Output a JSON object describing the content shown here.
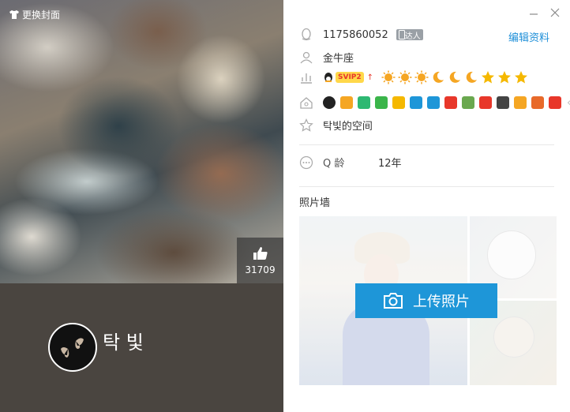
{
  "cover": {
    "change_label": "更换封面",
    "likes": "31709"
  },
  "profile": {
    "nickname": "탁 빛"
  },
  "info": {
    "qq_number": "1175860052",
    "daren_badge": "达人",
    "edit_label": "编辑资料",
    "zodiac": "金牛座",
    "vip_label": "SVIP2",
    "space_name": "탁빛的空间",
    "age_label": "Q 龄",
    "age_value": "12年",
    "photo_wall_title": "照片墙",
    "upload_label": "上传照片"
  },
  "level_icons": [
    "sun-icon",
    "sun-icon",
    "sun-icon",
    "moon-icon",
    "moon-icon",
    "moon-icon",
    "star-icon",
    "star-icon",
    "star-icon"
  ],
  "service_badges": [
    "qq-penguin-icon",
    "badge-1",
    "badge-2",
    "badge-3",
    "badge-4",
    "badge-5",
    "badge-6",
    "badge-7",
    "badge-8",
    "badge-9",
    "badge-10",
    "badge-11",
    "badge-12",
    "badge-13"
  ],
  "colors": {
    "accent": "#1e96d8",
    "link": "#1e8fd8",
    "sun": "#f5a623",
    "moon": "#f5a623",
    "star": "#f5b800"
  }
}
